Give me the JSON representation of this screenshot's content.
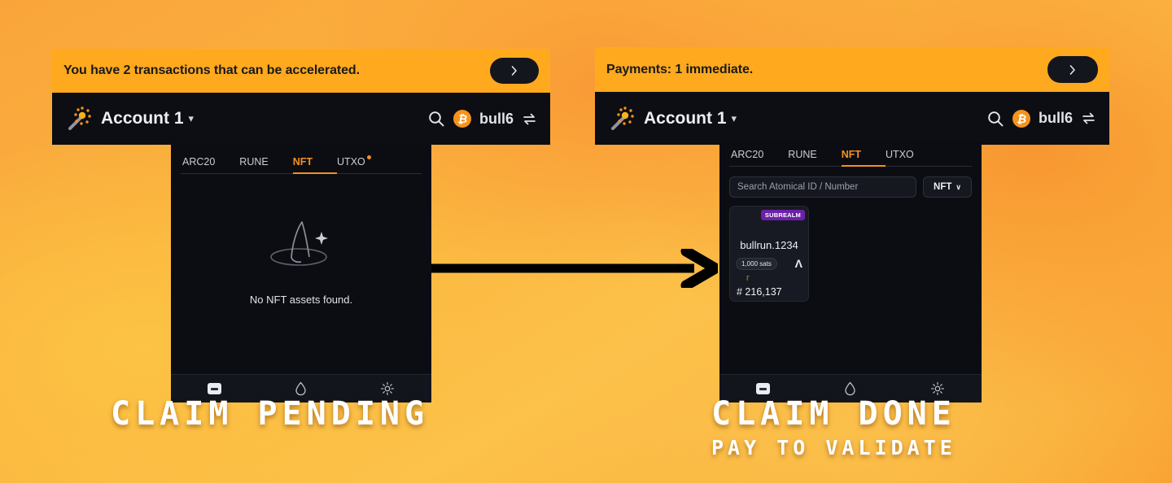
{
  "background": {
    "gradient_from": "#f9a43a",
    "gradient_to": "#fcc24a",
    "accent": "#f59021"
  },
  "arrow": {
    "name": "flow-arrow-right",
    "color": "#000000"
  },
  "left_panel": {
    "notification": {
      "text": "You have 2 transactions that can be accelerated.",
      "button_icon": "chevron-right-icon"
    },
    "account": {
      "wand_icon": "magic-wand-icon",
      "name": "Account 1",
      "caret": "▾",
      "search_icon": "search-icon",
      "coin_icon": "bitcoin-icon",
      "coin_symbol": "₿",
      "network_label": "bull6",
      "swap_icon": "swap-icon"
    },
    "tabs": [
      {
        "label": "ARC20",
        "active": false,
        "dot": false
      },
      {
        "label": "RUNE",
        "active": false,
        "dot": false
      },
      {
        "label": "NFT",
        "active": true,
        "dot": false
      },
      {
        "label": "UTXO",
        "active": false,
        "dot": true
      }
    ],
    "empty_state": {
      "icon": "wizard-hat-icon",
      "text": "No NFT assets found."
    },
    "bottom_nav": [
      {
        "icon": "wallet-icon",
        "active": true
      },
      {
        "icon": "flame-icon",
        "active": false
      },
      {
        "icon": "gear-icon",
        "active": false
      }
    ],
    "caption": {
      "line1": "CLAIM PENDING",
      "line2": ""
    }
  },
  "right_panel": {
    "notification": {
      "text": "Payments: 1 immediate.",
      "button_icon": "chevron-right-icon"
    },
    "account": {
      "wand_icon": "magic-wand-icon",
      "name": "Account 1",
      "caret": "▾",
      "search_icon": "search-icon",
      "coin_icon": "bitcoin-icon",
      "coin_symbol": "₿",
      "network_label": "bull6",
      "swap_icon": "swap-icon"
    },
    "tabs": [
      {
        "label": "ARC20",
        "active": false,
        "dot": false
      },
      {
        "label": "RUNE",
        "active": false,
        "dot": false
      },
      {
        "label": "NFT",
        "active": true,
        "dot": false
      },
      {
        "label": "UTXO",
        "active": false,
        "dot": false
      }
    ],
    "search": {
      "placeholder": "Search Atomical ID / Number",
      "value": "",
      "type_filter_label": "NFT",
      "type_filter_caret": "∨"
    },
    "nft_card": {
      "badge": "SUBREALM",
      "badge_color": "#6b21a8",
      "title": "bullrun.1234",
      "sats": "1,000 sats",
      "atomicals_mark": "Λ",
      "tick": "г",
      "number": "# 216,137"
    },
    "bottom_nav": [
      {
        "icon": "wallet-icon",
        "active": true
      },
      {
        "icon": "flame-icon",
        "active": false
      },
      {
        "icon": "gear-icon",
        "active": false
      }
    ],
    "caption": {
      "line1": "CLAIM DONE",
      "line2": "PAY TO VALIDATE"
    }
  }
}
